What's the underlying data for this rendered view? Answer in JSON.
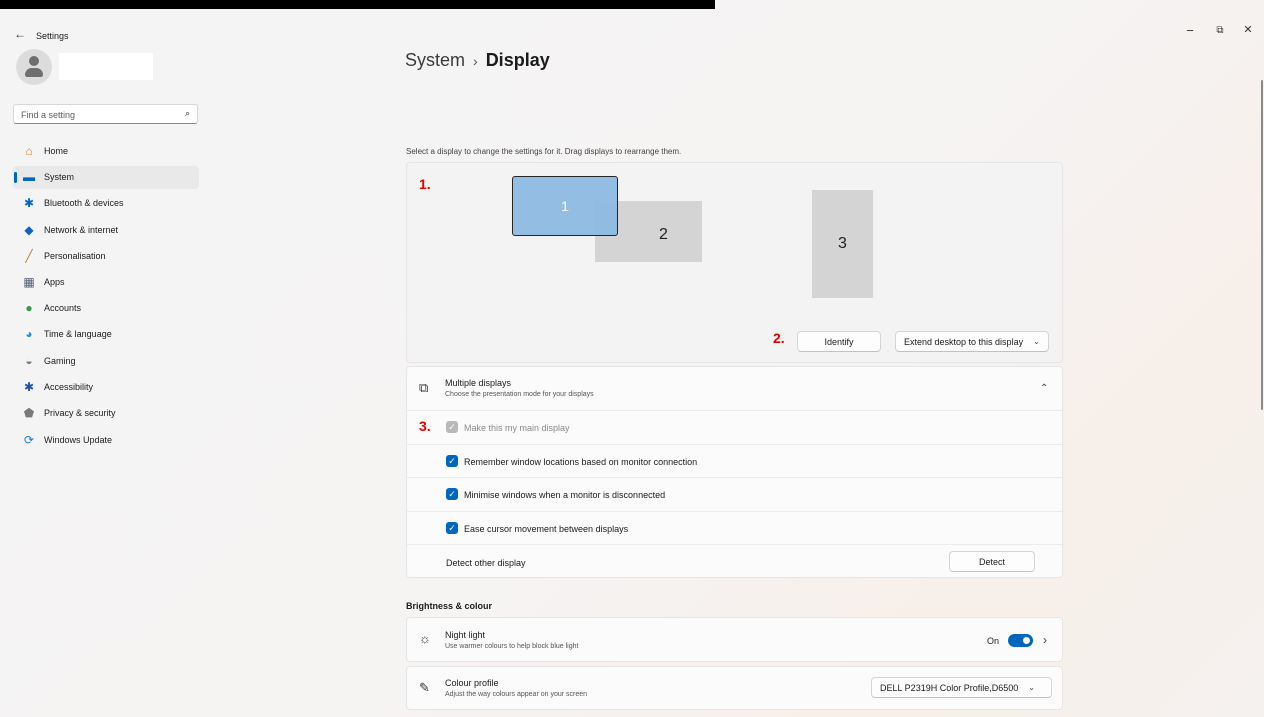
{
  "window": {
    "app_title": "Settings",
    "back_icon": "←",
    "controls": {
      "minimize": "−",
      "restore": "⧉",
      "close": "✕"
    }
  },
  "search": {
    "placeholder": "Find a setting",
    "icon": "⌕"
  },
  "sidebar": {
    "items": [
      {
        "label": "Home",
        "icon": "home-icon",
        "glyph": "⌂",
        "color": "#e08a1e"
      },
      {
        "label": "System",
        "icon": "system-icon",
        "glyph": "▬",
        "color": "#0067c0",
        "active": true
      },
      {
        "label": "Bluetooth & devices",
        "icon": "bluetooth-icon",
        "glyph": "✱",
        "color": "#0067c0"
      },
      {
        "label": "Network & internet",
        "icon": "wifi-icon",
        "glyph": "◆",
        "color": "#0a64c4"
      },
      {
        "label": "Personalisation",
        "icon": "brush-icon",
        "glyph": "╱",
        "color": "#b37a2f"
      },
      {
        "label": "Apps",
        "icon": "apps-icon",
        "glyph": "▦",
        "color": "#4d5b72"
      },
      {
        "label": "Accounts",
        "icon": "accounts-icon",
        "glyph": "●",
        "color": "#2f9c4a"
      },
      {
        "label": "Time & language",
        "icon": "globe-icon",
        "glyph": "◕",
        "color": "#2a8fd6"
      },
      {
        "label": "Gaming",
        "icon": "gamepad-icon",
        "glyph": "◒",
        "color": "#7d7d7d"
      },
      {
        "label": "Accessibility",
        "icon": "accessibility-icon",
        "glyph": "✱",
        "color": "#1b4fa8"
      },
      {
        "label": "Privacy & security",
        "icon": "shield-icon",
        "glyph": "⬟",
        "color": "#7a7a7a"
      },
      {
        "label": "Windows Update",
        "icon": "update-icon",
        "glyph": "⟳",
        "color": "#1e7ad6"
      }
    ]
  },
  "breadcrumb": {
    "parent": "System",
    "separator": "›",
    "current": "Display"
  },
  "arrangement": {
    "hint": "Select a display to change the settings for it. Drag displays to rearrange them.",
    "monitors": [
      "1",
      "2",
      "3"
    ],
    "selected_monitor": "1",
    "identify_label": "Identify",
    "extend_dropdown": {
      "value": "Extend desktop to this display",
      "chevron": "⌄"
    }
  },
  "annotations": {
    "a1": "1.",
    "a2": "2.",
    "a3": "3."
  },
  "multiple_displays": {
    "icon": "multiple-displays-icon",
    "title": "Multiple displays",
    "subtitle": "Choose the presentation mode for your displays",
    "chevron": "⌃",
    "options": [
      {
        "label": "Make this my main display",
        "checked": true,
        "disabled": true
      },
      {
        "label": "Remember window locations based on monitor connection",
        "checked": true,
        "disabled": false
      },
      {
        "label": "Minimise windows when a monitor is disconnected",
        "checked": true,
        "disabled": false
      },
      {
        "label": "Ease cursor movement between displays",
        "checked": true,
        "disabled": false
      }
    ],
    "detect_label": "Detect other display",
    "detect_button": "Detect"
  },
  "brightness": {
    "section_title": "Brightness & colour",
    "night_light": {
      "title": "Night light",
      "subtitle": "Use warmer colours to help block blue light",
      "state": "On",
      "on": true,
      "chevron": "›"
    },
    "colour_profile": {
      "title": "Colour profile",
      "subtitle": "Adjust the way colours appear on your screen",
      "value": "DELL P2319H Color Profile,D6500",
      "chevron": "⌄"
    }
  },
  "colors": {
    "accent": "#0067c0",
    "annotation": "#e00000",
    "selected_monitor": "#8ebbe2"
  }
}
